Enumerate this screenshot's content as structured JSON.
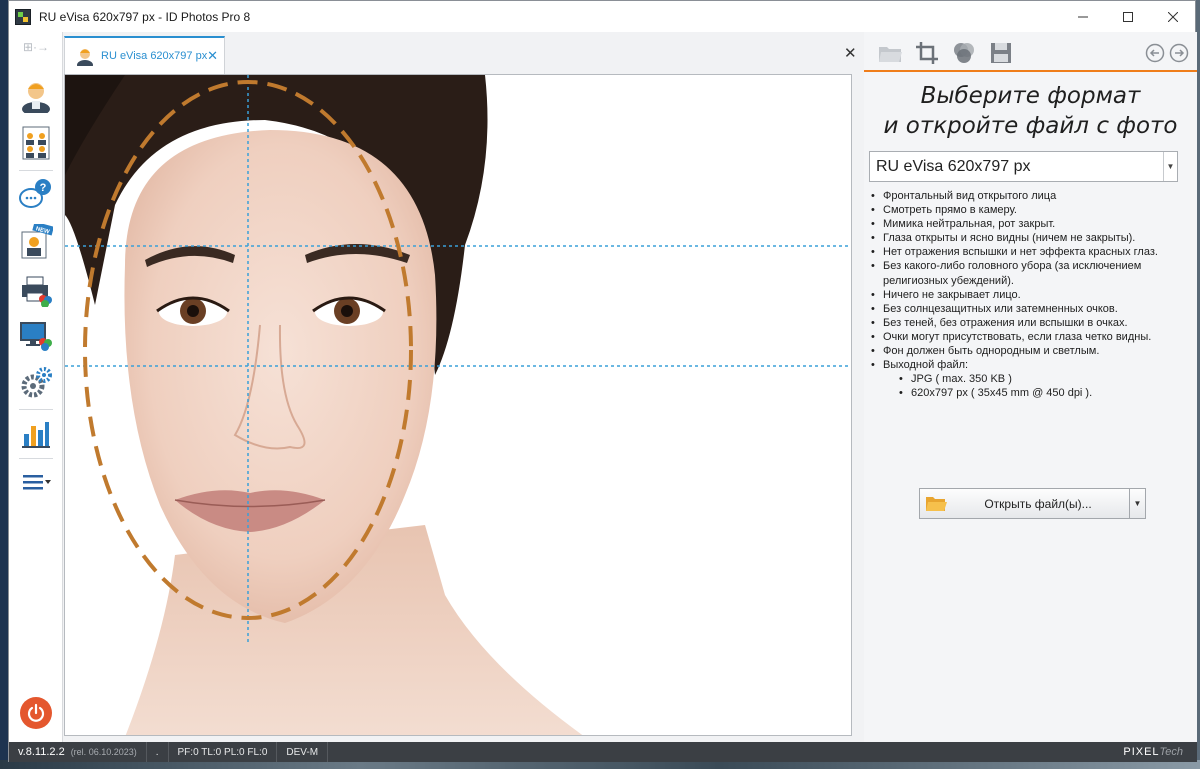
{
  "window": {
    "title": "RU eVisa 620x797 px - ID Photos Pro 8",
    "minimize_label": "Minimize",
    "maximize_label": "Maximize",
    "close_label": "Close"
  },
  "sidebar": {
    "items": [
      {
        "name": "single-photo",
        "icon": "person-icon"
      },
      {
        "name": "batch",
        "icon": "group-icon"
      },
      {
        "name": "help",
        "icon": "help-bubble-icon"
      },
      {
        "name": "new-profile",
        "icon": "new-person-icon"
      },
      {
        "name": "print",
        "icon": "printer-icon"
      },
      {
        "name": "display",
        "icon": "monitor-icon"
      },
      {
        "name": "settings",
        "icon": "gears-icon"
      },
      {
        "name": "statistics",
        "icon": "bar-chart-icon"
      },
      {
        "name": "menu",
        "icon": "menu-icon"
      }
    ]
  },
  "tab": {
    "label": "RU eVisa 620x797 px",
    "close": "✕"
  },
  "tabstrip_close": "✕",
  "right_panel": {
    "heading_line1": "Выберите формат",
    "heading_line2": "и откройте файл с фото",
    "format_select": "RU eVisa 620x797 px",
    "requirements": [
      "Фронтальный вид открытого лица",
      "Смотреть прямо в камеру.",
      "Мимика нейтральная, рот закрыт.",
      "Глаза открыты и ясно видны (ничем не закрыты).",
      "Нет отражения вспышки и нет эффекта красных глаз.",
      "Без какого-либо головного убора (за исключением религиозных убеждений).",
      "Ничего не закрывает лицо.",
      "Без солнцезащитных или затемненных очков.",
      "Без теней, без отражения или вспышки в очках.",
      "Очки могут присутствовать, если глаза четко видны.",
      "Фон должен быть однородным и светлым.",
      "Выходной файл:"
    ],
    "output_details": [
      "JPG  ( max. 350 KB )",
      "620x797 px  ( 35x45 mm @ 450 dpi )."
    ],
    "open_button": "Открыть файл(ы)..."
  },
  "statusbar": {
    "version": "v.8.11.2.2",
    "release": "(rel. 06.10.2023)",
    "dot": ".",
    "counters": "PF:0 TL:0 PL:0 FL:0",
    "mode": "DEV-M",
    "brand_main": "PIXEL",
    "brand_tech": "Tech"
  },
  "colors": {
    "accent": "#2a8fd0",
    "orange": "#ef7d1a",
    "guide_oval": "#c07a2e",
    "guide_line": "#3aa0d8"
  }
}
